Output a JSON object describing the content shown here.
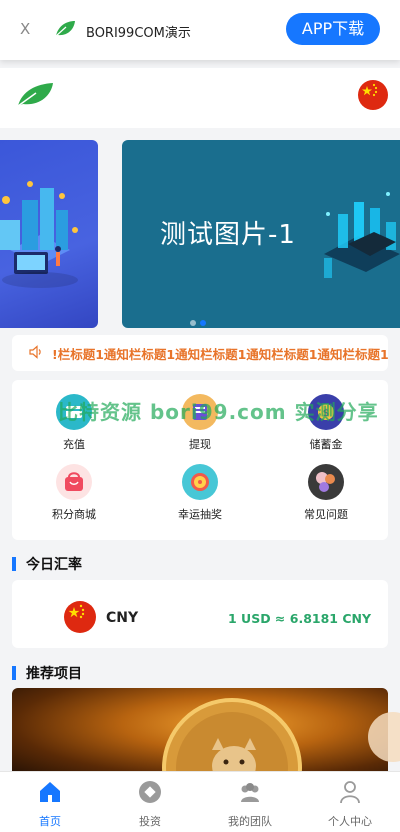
{
  "appbar": {
    "close": "X",
    "app_name": "BORI99COM演示",
    "download": "APP下载"
  },
  "banner": {
    "main_text": "测试图片-1",
    "slides": 2,
    "active_slide": 2
  },
  "notice": {
    "text": "!栏标题1通知栏标题1通知栏标题1通知栏标题1通知栏标题1"
  },
  "watermark": "比特资源 bori99.com 实测分享",
  "menu": [
    {
      "label": "充值",
      "icon": "recharge-icon",
      "color": "#2bb8c9"
    },
    {
      "label": "提现",
      "icon": "withdraw-icon",
      "color": "#f3b95f"
    },
    {
      "label": "储蓄金",
      "icon": "savings-icon",
      "color": "#3a3faa"
    },
    {
      "label": "积分商城",
      "icon": "points-mall-icon",
      "color": "#f06070"
    },
    {
      "label": "幸运抽奖",
      "icon": "lucky-draw-icon",
      "color": "#47c7d6"
    },
    {
      "label": "常见问题",
      "icon": "faq-icon",
      "color": "#3a3a3a"
    }
  ],
  "rates": {
    "title": "今日汇率",
    "currency": "CNY",
    "value": "1 USD ≈ 6.8181 CNY"
  },
  "projects": {
    "title": "推荐项目"
  },
  "tabs": [
    {
      "label": "首页",
      "icon": "home-icon",
      "active": true
    },
    {
      "label": "投资",
      "icon": "invest-icon",
      "active": false
    },
    {
      "label": "我的团队",
      "icon": "team-icon",
      "active": false
    },
    {
      "label": "个人中心",
      "icon": "profile-icon",
      "active": false
    }
  ],
  "colors": {
    "primary": "#1677ff",
    "notice": "#e8742a",
    "rate": "#2aa66a"
  }
}
